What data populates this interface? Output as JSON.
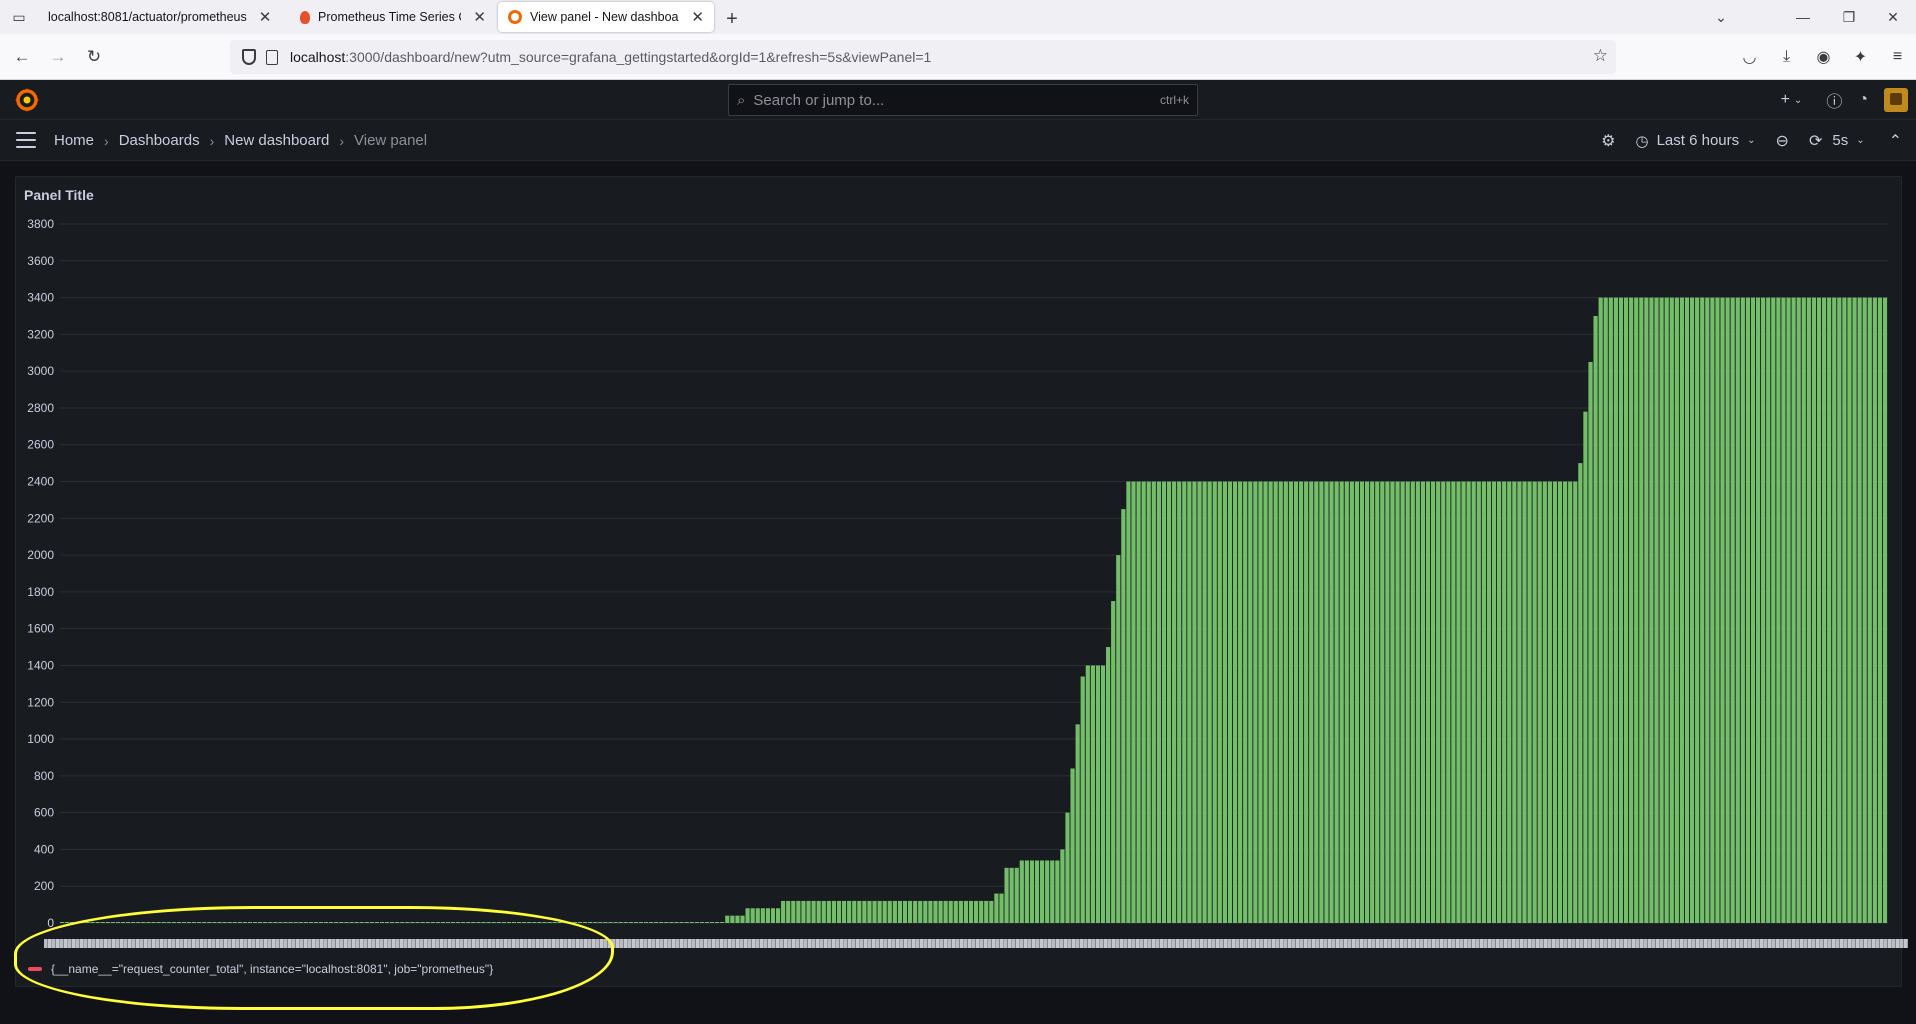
{
  "browser": {
    "tabs": [
      {
        "title": "localhost:8081/actuator/prometheus",
        "icon": "page-icon",
        "active": false
      },
      {
        "title": "Prometheus Time Series Collect",
        "icon": "prometheus-icon",
        "active": false
      },
      {
        "title": "View panel - New dashboard - G",
        "icon": "grafana-icon",
        "active": true
      }
    ],
    "url_host": "localhost",
    "url_rest": ":3000/dashboard/new?utm_source=grafana_gettingstarted&orgId=1&refresh=5s&viewPanel=1"
  },
  "grafana": {
    "search_placeholder": "Search or jump to...",
    "search_shortcut": "ctrl+k",
    "breadcrumbs": [
      "Home",
      "Dashboards",
      "New dashboard",
      "View panel"
    ],
    "time_range": "Last 6 hours",
    "refresh_interval": "5s",
    "panel_title": "Panel Title",
    "legend_label": "{__name__=\"request_counter_total\", instance=\"localhost:8081\", job=\"prometheus\"}",
    "colors": {
      "bars": "#73bf69",
      "legend": "#f2495c",
      "annotation": "#ffff3a"
    }
  },
  "chart_data": {
    "type": "bar",
    "ylim": [
      0,
      3800
    ],
    "yticks": [
      0,
      200,
      400,
      600,
      800,
      1000,
      1200,
      1400,
      1600,
      1800,
      2000,
      2200,
      2400,
      2600,
      2800,
      3000,
      3200,
      3400,
      3600,
      3800
    ],
    "grid": true,
    "bar_count": 360,
    "segments": [
      {
        "from_bar": 0,
        "to_bar": 130,
        "value": 0
      },
      {
        "from_bar": 131,
        "to_bar": 134,
        "value": 40
      },
      {
        "from_bar": 135,
        "to_bar": 141,
        "value": 80
      },
      {
        "from_bar": 142,
        "to_bar": 183,
        "value": 120
      },
      {
        "from_bar": 184,
        "to_bar": 185,
        "value": 160
      },
      {
        "from_bar": 186,
        "to_bar": 188,
        "value": 300
      },
      {
        "from_bar": 189,
        "to_bar": 196,
        "value": 340
      },
      {
        "from_bar": 197,
        "to_bar": 197,
        "value": 400
      },
      {
        "from_bar": 198,
        "to_bar": 198,
        "value": 600
      },
      {
        "from_bar": 199,
        "to_bar": 199,
        "value": 840
      },
      {
        "from_bar": 200,
        "to_bar": 200,
        "value": 1080
      },
      {
        "from_bar": 201,
        "to_bar": 201,
        "value": 1340
      },
      {
        "from_bar": 202,
        "to_bar": 205,
        "value": 1400
      },
      {
        "from_bar": 206,
        "to_bar": 206,
        "value": 1500
      },
      {
        "from_bar": 207,
        "to_bar": 207,
        "value": 1750
      },
      {
        "from_bar": 208,
        "to_bar": 208,
        "value": 2000
      },
      {
        "from_bar": 209,
        "to_bar": 209,
        "value": 2250
      },
      {
        "from_bar": 210,
        "to_bar": 298,
        "value": 2400
      },
      {
        "from_bar": 299,
        "to_bar": 299,
        "value": 2500
      },
      {
        "from_bar": 300,
        "to_bar": 300,
        "value": 2780
      },
      {
        "from_bar": 301,
        "to_bar": 301,
        "value": 3050
      },
      {
        "from_bar": 302,
        "to_bar": 302,
        "value": 3300
      },
      {
        "from_bar": 303,
        "to_bar": 359,
        "value": 3400
      }
    ]
  }
}
